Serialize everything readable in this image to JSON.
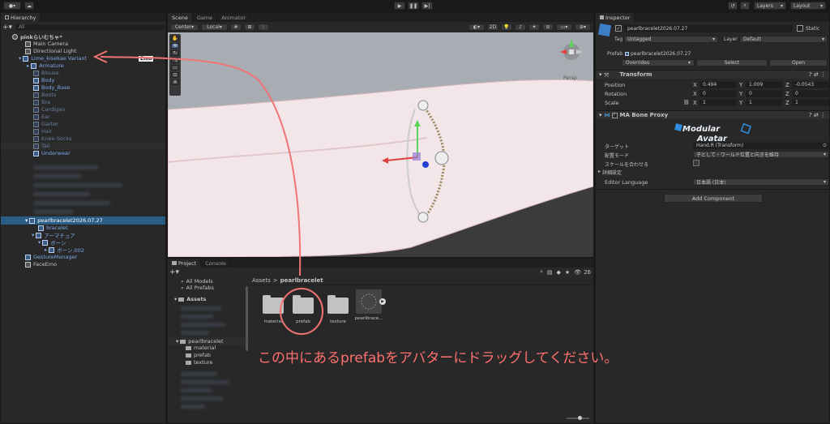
{
  "toolbar": {
    "layers": "Layers",
    "layout": "Layout"
  },
  "hierarchy": {
    "tab": "Hierarchy",
    "search": "All",
    "scene": "pinkらいむちゃ*",
    "items": [
      {
        "label": "Main Camera"
      },
      {
        "label": "Directional Light"
      },
      {
        "label": "Lime_kisekae Variant"
      },
      {
        "label": "Armature"
      },
      {
        "label": "Blouse"
      },
      {
        "label": "Body"
      },
      {
        "label": "Body_Base"
      },
      {
        "label": "Boots"
      },
      {
        "label": "Bra"
      },
      {
        "label": "Cardigan"
      },
      {
        "label": "Ear"
      },
      {
        "label": "Garter"
      },
      {
        "label": "Hair"
      },
      {
        "label": "Knee-Socks"
      },
      {
        "label": "Tail"
      },
      {
        "label": "Underwear"
      }
    ],
    "emo_badge": "Emo",
    "bracelet": "pearlbracelet2026.07.27",
    "sub1": "bracelet",
    "sub2": "アーマチュア",
    "sub3": "ボーン",
    "sub4": "ボーン.002",
    "gesture": "GestureManager",
    "faceemo": "FaceEmo"
  },
  "scene": {
    "tab_scene": "Scene",
    "tab_game": "Game",
    "tab_animator": "Animator",
    "center": "Center",
    "local": "Local",
    "mode_2d": "2D",
    "persp": "Persp"
  },
  "inspector": {
    "tab": "Inspector",
    "name": "pearlbracelet2026.07.27",
    "static": "Static",
    "tag_label": "Tag",
    "tag_value": "Untagged",
    "layer_label": "Layer",
    "layer_value": "Default",
    "prefab_label": "Prefab",
    "prefab_value": "pearlbracelet2026.07.27",
    "overrides": "Overrides",
    "select": "Select",
    "open": "Open",
    "transform": "Transform",
    "position": {
      "label": "Position",
      "x": "0.494",
      "y": "1.009",
      "z": "-0.0543"
    },
    "rotation": {
      "label": "Rotation",
      "x": "0",
      "y": "0",
      "z": "0"
    },
    "scale": {
      "label": "Scale",
      "x": "1",
      "y": "1",
      "z": "1"
    },
    "ma_title": "MA Bone Proxy",
    "logo_top": "Modular",
    "logo_bottom": "Avatar",
    "target_label": "ターゲット",
    "target_value": "Hand.R (Transform)",
    "mode_label": "配置モード",
    "mode_value": "子として・ワールド位置と向きを維持",
    "scale_match": "スケールを合わせる",
    "advanced": "詳細設定",
    "lang_label": "Editor Language",
    "lang_value": "日本語 (日本)",
    "add_component": "Add Component"
  },
  "project": {
    "tab_project": "Project",
    "tab_console": "Console",
    "count": "26",
    "fav1": "All Models",
    "fav2": "All Prefabs",
    "assets": "Assets",
    "tree_folder": "pearlbracelet",
    "tree_sub": [
      "material",
      "prefab",
      "texture"
    ],
    "breadcrumb_root": "Assets",
    "breadcrumb_sep": ">",
    "breadcrumb_leaf": "pearlbracelet",
    "items": [
      {
        "label": "material"
      },
      {
        "label": "prefab"
      },
      {
        "label": "texture"
      },
      {
        "label": "pearlbrace..."
      }
    ]
  },
  "annotation": "この中にあるprefabをアバターにドラッグしてください。",
  "colors": {
    "annotation": "#ff6f6f",
    "selection": "#2c5d87",
    "accent": "#4a90d9"
  }
}
